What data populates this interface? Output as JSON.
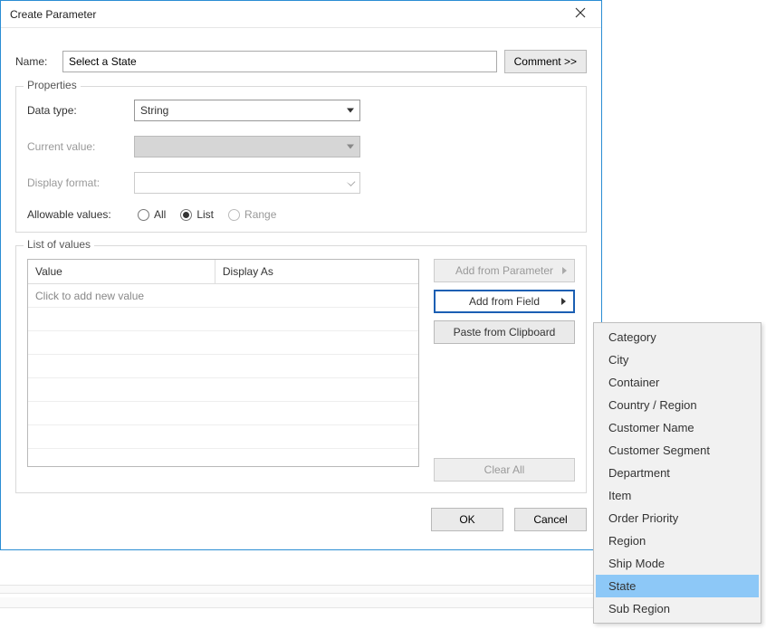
{
  "dialog": {
    "title": "Create Parameter",
    "name_label": "Name:",
    "name_value": "Select a State",
    "comment_btn": "Comment >>"
  },
  "properties": {
    "legend": "Properties",
    "data_type_label": "Data type:",
    "data_type_value": "String",
    "current_value_label": "Current value:",
    "current_value_value": "",
    "display_format_label": "Display format:",
    "display_format_value": "",
    "allowable_label": "Allowable values:",
    "allowable_options": {
      "all": "All",
      "list": "List",
      "range": "Range"
    },
    "allowable_selected": "list"
  },
  "list_values": {
    "legend": "List of values",
    "col_value": "Value",
    "col_display": "Display As",
    "placeholder": "Click to add new value",
    "add_from_parameter": "Add from Parameter",
    "add_from_field": "Add from Field",
    "paste_clipboard": "Paste from Clipboard",
    "clear_all": "Clear All"
  },
  "buttons": {
    "ok": "OK",
    "cancel": "Cancel"
  },
  "field_menu": {
    "items": [
      "Category",
      "City",
      "Container",
      "Country / Region",
      "Customer Name",
      "Customer Segment",
      "Department",
      "Item",
      "Order Priority",
      "Region",
      "Ship Mode",
      "State",
      "Sub Region"
    ],
    "highlight_index": 11
  }
}
